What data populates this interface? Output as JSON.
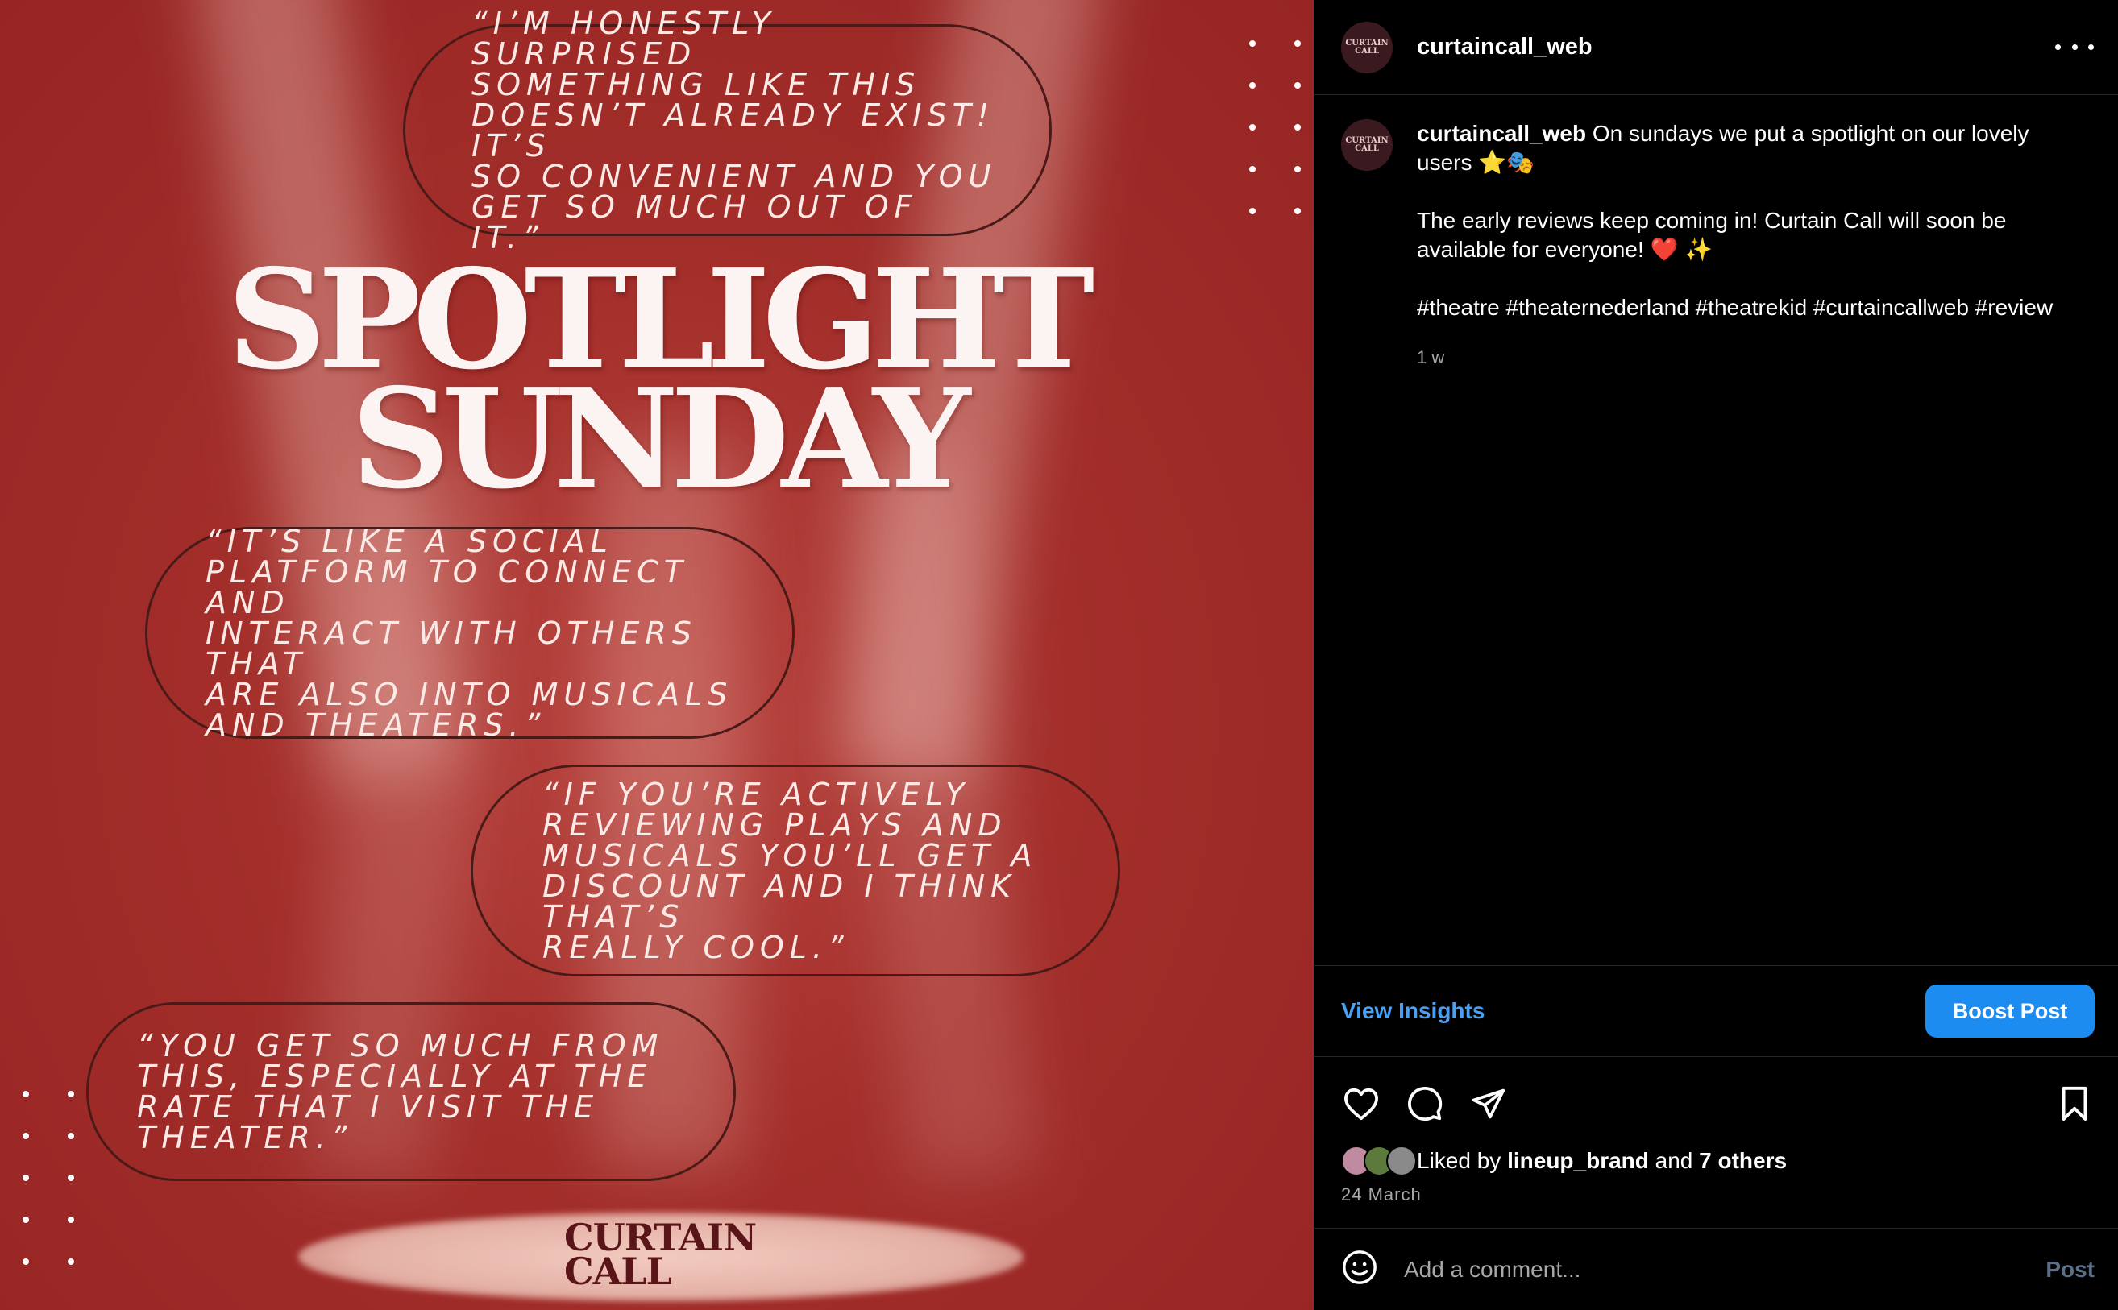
{
  "image": {
    "quotes": [
      [
        "“I’M HONESTLY SURPRISED",
        "SOMETHING LIKE THIS",
        "DOESN’T ALREADY EXIST! IT’S",
        "SO CONVENIENT AND YOU",
        "GET SO MUCH OUT OF IT.”"
      ],
      [
        "“IT’S LIKE A SOCIAL",
        "PLATFORM TO CONNECT AND",
        "INTERACT WITH OTHERS THAT",
        "ARE ALSO INTO MUSICALS",
        "AND THEATERS.”"
      ],
      [
        "“IF YOU’RE ACTIVELY",
        "REVIEWING PLAYS AND",
        "MUSICALS YOU’LL GET A",
        "DISCOUNT AND I THINK THAT’S",
        "REALLY COOL.”"
      ],
      [
        "“YOU GET SO MUCH FROM",
        "THIS, ESPECIALLY AT THE",
        "RATE THAT I VISIT THE",
        "THEATER.”"
      ]
    ],
    "headline_line1": "SPOTLIGHT",
    "headline_line2": "SUNDAY",
    "logo_line1": "CURTAIN",
    "logo_line2": "CALL"
  },
  "header": {
    "username": "curtaincall_web",
    "avatar_line1": "CURTAIN",
    "avatar_line2": "CALL"
  },
  "caption": {
    "username": "curtaincall_web",
    "line1": "On sundays we put a spotlight on our lovely users ⭐🎭",
    "line2": "The early reviews keep coming in! Curtain Call will soon be available for everyone! ❤️ ✨",
    "hashtags": "#theatre #theaternederland #theatrekid #curtaincallweb #review",
    "time": "1 w"
  },
  "insights": {
    "view_label": "View Insights",
    "boost_label": "Boost Post"
  },
  "likes": {
    "prefix": "Liked by",
    "user": "lineup_brand",
    "and": "and",
    "others": "7 others",
    "date": "24 March"
  },
  "comment": {
    "placeholder": "Add a comment...",
    "post_label": "Post"
  },
  "icons": [
    "heart-icon",
    "comment-icon",
    "share-icon",
    "bookmark-icon",
    "emoji-icon",
    "more-icon"
  ],
  "colors": {
    "background_red": "#a32e2a",
    "accent_blue": "#1d8cf0",
    "link_blue": "#4aa0f5"
  }
}
